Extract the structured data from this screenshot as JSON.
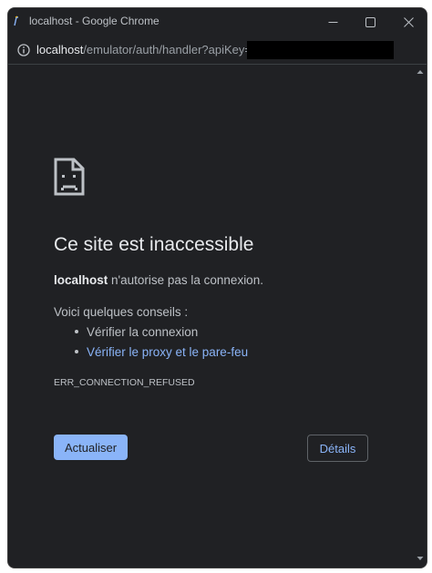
{
  "window": {
    "title": "localhost - Google Chrome"
  },
  "address_bar": {
    "host": "localhost",
    "path": "/emulator/auth/handler?apiKey="
  },
  "error_page": {
    "heading": "Ce site est inaccessible",
    "host": "localhost",
    "message": " n'autorise pas la connexion.",
    "tips_title": "Voici quelques conseils :",
    "tips": [
      "Vérifier la connexion",
      "Vérifier le proxy et le pare-feu"
    ],
    "error_code": "ERR_CONNECTION_REFUSED",
    "reload_label": "Actualiser",
    "details_label": "Détails"
  },
  "icons": {
    "favicon": "favicon-icon",
    "info": "info-icon",
    "sad_page": "sad-page-icon",
    "minimize": "minimize-icon",
    "maximize": "maximize-icon",
    "close": "close-icon"
  },
  "colors": {
    "background": "#202124",
    "text": "#bdc1c6",
    "link": "#8ab4f8",
    "button": "#8ab4f8"
  }
}
